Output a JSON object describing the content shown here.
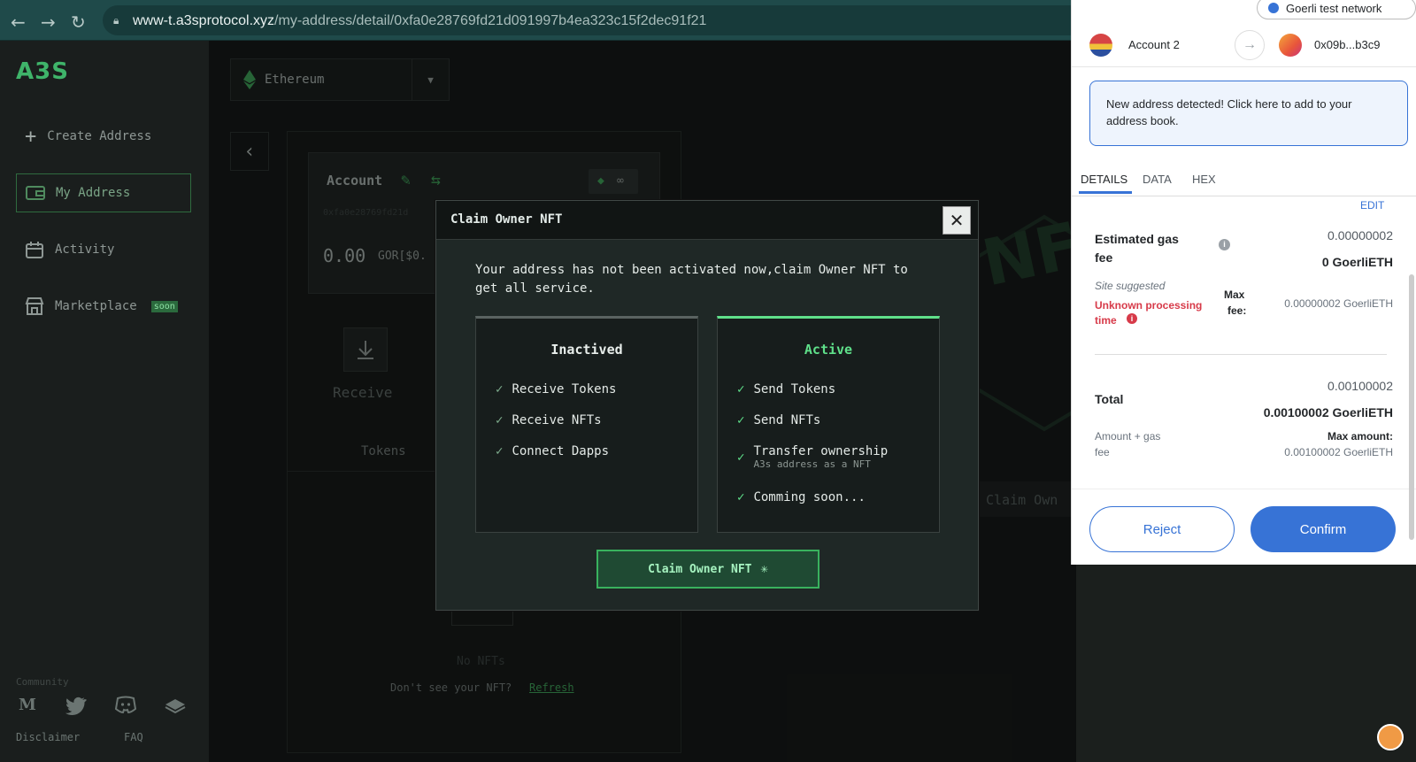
{
  "browser": {
    "url_host": "www-t.a3sprotocol.xyz",
    "url_path": "/my-address/detail/0xfa0e28769fd21d091997b4ea323c15f2dec91f21"
  },
  "sidebar": {
    "logo": "A3S",
    "items": [
      {
        "label": "Create Address",
        "icon": "plus-icon"
      },
      {
        "label": "My Address",
        "icon": "wallet-icon"
      },
      {
        "label": "Activity",
        "icon": "calendar-icon"
      },
      {
        "label": "Marketplace",
        "icon": "store-icon",
        "badge": "soon"
      }
    ],
    "community_label": "Community",
    "social_icons": [
      "medium-icon",
      "twitter-icon",
      "discord-icon",
      "gitbook-icon"
    ],
    "footer_links": [
      "Disclaimer",
      "FAQ"
    ]
  },
  "main": {
    "chain": "Ethereum",
    "account_label": "Account",
    "address_short": "0xfa0e28769fd21d",
    "balance": "0.00",
    "balance_unit": "GOR[$0.",
    "receive_label": "Receive",
    "tokens_tab": "Tokens",
    "no_nfts": "No NFTs",
    "dont_see": "Don't see your NFT?",
    "refresh": "Refresh",
    "nft_bg_text": "NFT",
    "claim_own_partial": "Claim Own"
  },
  "modal": {
    "title": "Claim Owner NFT",
    "message": "Your address has not been activated now,claim Owner NFT to get all service.",
    "inactive": {
      "title": "Inactived",
      "features": [
        "Receive Tokens",
        "Receive NFTs",
        "Connect Dapps"
      ]
    },
    "active": {
      "title": "Active",
      "features": [
        "Send Tokens",
        "Send NFTs",
        "Transfer ownership",
        "Comming soon..."
      ],
      "transfer_sub": "A3s address as a NFT"
    },
    "claim_button": "Claim Owner NFT"
  },
  "metamask": {
    "network": "Goerli test network",
    "from_account": "Account 2",
    "to_address": "0x09b...b3c9",
    "notice": "New address detected! Click here to add to your address book.",
    "tabs": [
      "DETAILS",
      "DATA",
      "HEX"
    ],
    "edit": "EDIT",
    "est_gas_label_1": "Estimated gas",
    "est_gas_label_2": "fee",
    "est_gas_value": "0.00000002",
    "est_gas_eth": "0 GoerliETH",
    "site_suggested": "Site suggested",
    "unknown_time_1": "Unknown processing",
    "unknown_time_2": "time",
    "max_fee_label_1": "Max",
    "max_fee_label_2": "fee:",
    "max_fee_value": "0.00000002 GoerliETH",
    "total_label": "Total",
    "total_value": "0.00100002",
    "total_eth": "0.00100002 GoerliETH",
    "amount_gas_1": "Amount + gas",
    "amount_gas_2": "fee",
    "max_amount_label": "Max amount:",
    "max_amount_value": "0.00100002 GoerliETH",
    "reject": "Reject",
    "confirm": "Confirm"
  }
}
